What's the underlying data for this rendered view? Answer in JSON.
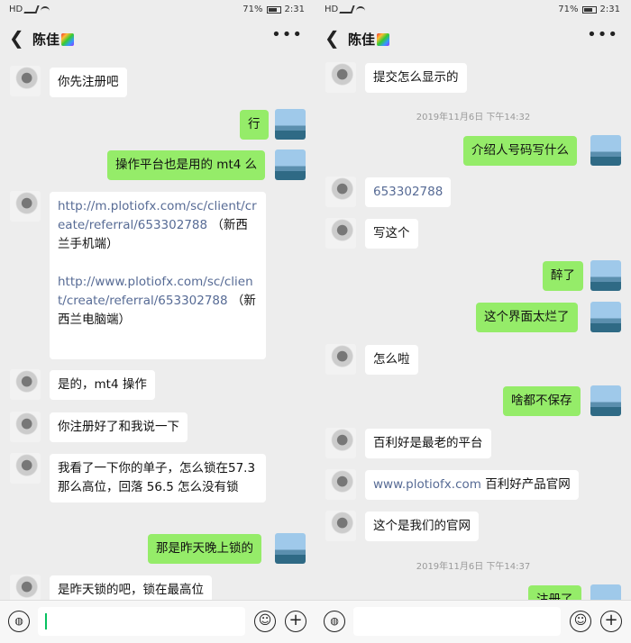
{
  "status": {
    "carrier": "HD",
    "battery": "71%",
    "time": "2:31"
  },
  "contact": {
    "name": "陈佳"
  },
  "left": {
    "messages": [
      {
        "side": "in",
        "text": "你先注册吧"
      },
      {
        "side": "out",
        "text": "行"
      },
      {
        "side": "out",
        "text": "操作平台也是用的 mt4 么"
      },
      {
        "side": "in",
        "link1": "http://m.plotiofx.com/sc/client/create/referral/653302788",
        "text1": "（新西兰手机端）",
        "link2": "http://www.plotiofx.com/sc/client/create/referral/653302788",
        "text2": "（新西兰电脑端）"
      },
      {
        "side": "in",
        "text": "是的，mt4 操作"
      },
      {
        "side": "in",
        "text": "你注册好了和我说一下"
      },
      {
        "side": "in",
        "text": "我看了一下你的单子，怎么锁在57.3 那么高位，回落 56.5 怎么没有锁"
      },
      {
        "side": "out",
        "text": "那是昨天晚上锁的"
      },
      {
        "side": "in",
        "text": "是昨天锁的吧，锁在最高位"
      }
    ]
  },
  "right": {
    "messages": [
      {
        "side": "in",
        "text": "提交怎么显示的"
      },
      {
        "type": "time",
        "text": "2019年11月6日 下午14:32"
      },
      {
        "side": "out",
        "text": "介绍人号码写什么"
      },
      {
        "side": "in",
        "text": "653302788"
      },
      {
        "side": "in",
        "text": "写这个"
      },
      {
        "side": "out",
        "text": "醉了"
      },
      {
        "side": "out",
        "text": "这个界面太烂了"
      },
      {
        "side": "in",
        "text": "怎么啦"
      },
      {
        "side": "out",
        "text": "啥都不保存"
      },
      {
        "side": "in",
        "text": "百利好是最老的平台"
      },
      {
        "side": "in",
        "link": "www.plotiofx.com",
        "text": " 百利好产品官网"
      },
      {
        "side": "in",
        "text": "这个是我们的官网"
      },
      {
        "type": "time",
        "text": "2019年11月6日 下午14:37"
      },
      {
        "side": "out",
        "text": "注册了"
      }
    ]
  },
  "icons": {
    "back": "back-arrow-icon",
    "more": "more-icon",
    "voice": "voice-icon",
    "emoji": "emoji-icon",
    "plus": "plus-icon"
  }
}
